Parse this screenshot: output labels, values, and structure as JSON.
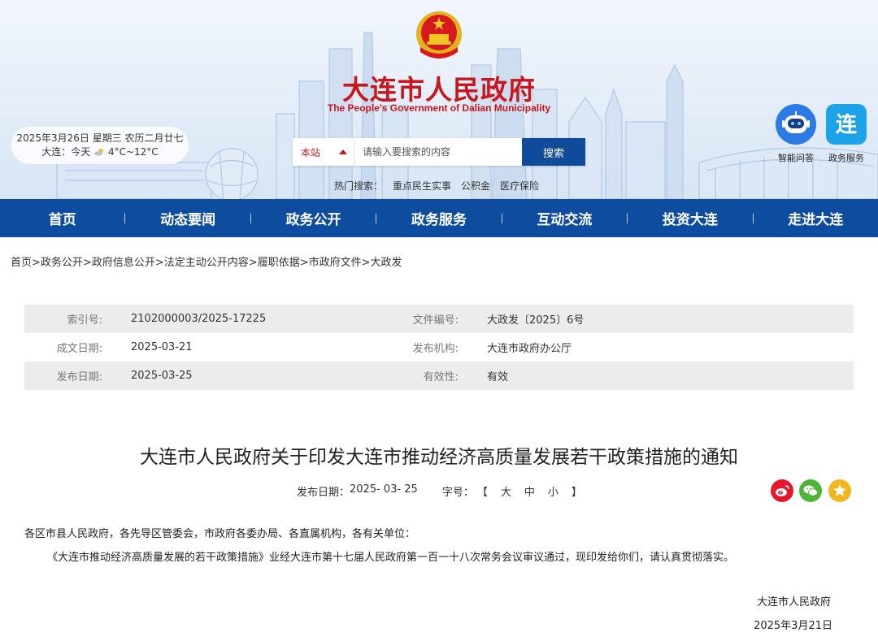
{
  "header": {
    "title": "大连市人民政府",
    "subtitle": "The People's Government of Dalian Municipality",
    "date_line": "2025年3月26日 星期三 农历二月廿七",
    "weather_city": "大连：今天",
    "weather_temp": "4°C~12°C",
    "weather_icon": "cloud-sun-icon"
  },
  "search": {
    "scope": "本站",
    "placeholder": "请输入要搜索的内容",
    "button": "搜索",
    "hot_label": "热门搜索：",
    "hot_items": [
      "重点民生实事",
      "公积金",
      "医疗保险"
    ]
  },
  "tools": {
    "ai_label": "智能问答",
    "service_label": "政务服务",
    "service_glyph": "连"
  },
  "nav": {
    "items": [
      "首页",
      "动态要闻",
      "政务公开",
      "政务服务",
      "互动交流",
      "投资大连",
      "走进大连"
    ]
  },
  "breadcrumb": {
    "items": [
      "首页",
      "政务公开",
      "政府信息公开",
      "法定主动公开内容",
      "履职依据",
      "市政府文件",
      "大政发"
    ],
    "separator": ">"
  },
  "meta": {
    "rows": [
      {
        "k1": "索引号:",
        "v1": "2102000003/2025-17225",
        "k2": "文件编号:",
        "v2": "大政发〔2025〕6号"
      },
      {
        "k1": "成文日期:",
        "v1": "2025-03-21",
        "k2": "发布机构:",
        "v2": "大连市政府办公厅"
      },
      {
        "k1": "发布日期:",
        "v1": "2025-03-25",
        "k2": "有效性:",
        "v2": "有效"
      }
    ]
  },
  "article": {
    "title": "大连市人民政府关于印发大连市推动经济高质量发展若干政策措施的通知",
    "publish_label": "发布日期：",
    "publish_date": "2025- 03- 25",
    "font_label": "字号：",
    "font_open": "【",
    "font_large": "大",
    "font_medium": "中",
    "font_small": "小",
    "font_close": "】",
    "salutation": "各区市县人民政府，各先导区管委会，市政府各委办局、各直属机构，各有关单位：",
    "paragraph": "《大连市推动经济高质量发展的若干政策措施》业经大连市第十七届人民政府第一百一十八次常务会议审议通过，现印发给你们，请认真贯彻落实。",
    "signature_org": "大连市人民政府",
    "signature_date": "2025年3月21日"
  },
  "colors": {
    "brand_red": "#c8161d",
    "nav_blue": "#0d4c9e",
    "meta_bg": "#ececec"
  }
}
